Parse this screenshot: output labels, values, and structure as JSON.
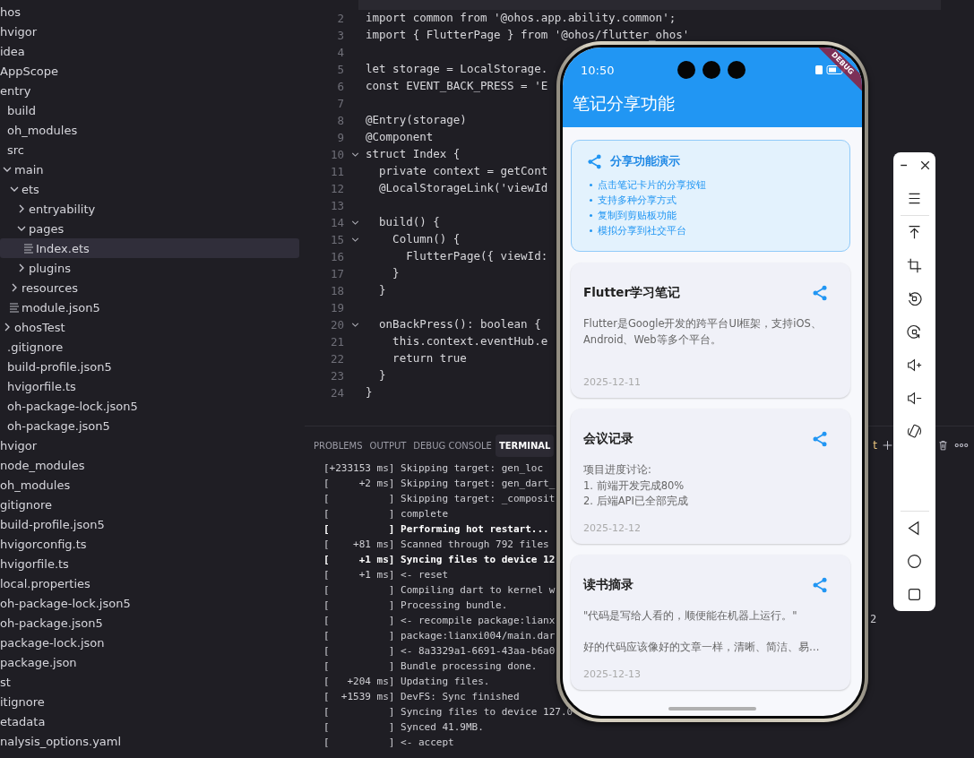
{
  "explorer": {
    "items": [
      {
        "name": "hos",
        "kind": "plain",
        "selected": false
      },
      {
        "name": "hvigor",
        "kind": "plain",
        "selected": false
      },
      {
        "name": "idea",
        "kind": "plain",
        "selected": false
      },
      {
        "name": "AppScope",
        "kind": "plain",
        "selected": false
      },
      {
        "name": "entry",
        "kind": "plain",
        "selected": false,
        "children": [
          {
            "name": "build",
            "kind": "plain",
            "selected": false
          },
          {
            "name": "oh_modules",
            "kind": "plain",
            "selected": false
          },
          {
            "name": "src",
            "kind": "plain",
            "selected": false,
            "children": [
              {
                "name": "main",
                "kind": "folder",
                "expanded": true,
                "selected": false,
                "children": [
                  {
                    "name": "ets",
                    "kind": "folder",
                    "expanded": true,
                    "selected": false,
                    "children": [
                      {
                        "name": "entryability",
                        "kind": "folder",
                        "expanded": false,
                        "selected": false
                      },
                      {
                        "name": "pages",
                        "kind": "folder",
                        "expanded": true,
                        "selected": false,
                        "children": [
                          {
                            "name": "Index.ets",
                            "kind": "file",
                            "selected": true
                          }
                        ]
                      },
                      {
                        "name": "plugins",
                        "kind": "folder",
                        "expanded": false,
                        "selected": false
                      }
                    ]
                  },
                  {
                    "name": "resources",
                    "kind": "folder",
                    "expanded": false,
                    "selected": false
                  },
                  {
                    "name": "module.json5",
                    "kind": "file",
                    "selected": false
                  }
                ]
              },
              {
                "name": "ohosTest",
                "kind": "folder",
                "expanded": false,
                "selected": false
              }
            ]
          },
          {
            "name": ".gitignore",
            "kind": "plain",
            "selected": false
          },
          {
            "name": "build-profile.json5",
            "kind": "plain",
            "selected": false
          },
          {
            "name": "hvigorfile.ts",
            "kind": "plain",
            "selected": false
          },
          {
            "name": "oh-package-lock.json5",
            "kind": "plain",
            "selected": false
          },
          {
            "name": "oh-package.json5",
            "kind": "plain",
            "selected": false
          }
        ]
      },
      {
        "name": "hvigor",
        "kind": "plain",
        "selected": false
      },
      {
        "name": "node_modules",
        "kind": "plain",
        "selected": false
      },
      {
        "name": "oh_modules",
        "kind": "plain",
        "selected": false
      },
      {
        "name": "gitignore",
        "kind": "plain",
        "selected": false
      },
      {
        "name": "build-profile.json5",
        "kind": "plain",
        "selected": false
      },
      {
        "name": "hvigorconfig.ts",
        "kind": "plain",
        "selected": false
      },
      {
        "name": "hvigorfile.ts",
        "kind": "plain",
        "selected": false
      },
      {
        "name": "local.properties",
        "kind": "plain",
        "selected": false
      },
      {
        "name": "oh-package-lock.json5",
        "kind": "plain",
        "selected": false
      },
      {
        "name": "oh-package.json5",
        "kind": "plain",
        "selected": false
      },
      {
        "name": "package-lock.json",
        "kind": "plain",
        "selected": false
      },
      {
        "name": "package.json",
        "kind": "plain",
        "selected": false
      },
      {
        "name": "st",
        "kind": "plain",
        "selected": false
      },
      {
        "name": "itignore",
        "kind": "plain",
        "selected": false
      },
      {
        "name": "etadata",
        "kind": "plain",
        "selected": false
      },
      {
        "name": "nalysis_options.yaml",
        "kind": "plain",
        "selected": false
      }
    ]
  },
  "editor": {
    "lines": [
      {
        "current": true,
        "foldable": false
      },
      {
        "number": "2",
        "text": "import common from '@ohos.app.ability.common';",
        "current": false,
        "foldable": false
      },
      {
        "number": "3",
        "text": "import { FlutterPage } from '@ohos/flutter_ohos'",
        "current": false,
        "foldable": false
      },
      {
        "number": "4",
        "current": false,
        "foldable": false
      },
      {
        "number": "5",
        "text": "let storage = LocalStorage.",
        "current": false,
        "foldable": false
      },
      {
        "number": "6",
        "text": "const EVENT_BACK_PRESS = 'E",
        "current": false,
        "foldable": false
      },
      {
        "number": "7",
        "current": false,
        "foldable": false
      },
      {
        "number": "8",
        "text": "@Entry(storage)",
        "current": false,
        "foldable": false
      },
      {
        "number": "9",
        "text": "@Component",
        "current": false,
        "foldable": false
      },
      {
        "number": "10",
        "text": "struct Index {",
        "current": false,
        "foldable": true
      },
      {
        "number": "11",
        "text": "  private context = getCont",
        "current": false,
        "foldable": false
      },
      {
        "number": "12",
        "text": "  @LocalStorageLink('viewId",
        "current": false,
        "foldable": false
      },
      {
        "number": "13",
        "current": false,
        "foldable": false
      },
      {
        "number": "14",
        "text": "  build() {",
        "current": false,
        "foldable": true
      },
      {
        "number": "15",
        "text": "    Column() {",
        "current": false,
        "foldable": true
      },
      {
        "number": "16",
        "text": "      FlutterPage({ viewId:",
        "current": false,
        "foldable": false
      },
      {
        "number": "17",
        "text": "    }",
        "current": false,
        "foldable": false
      },
      {
        "number": "18",
        "text": "  }",
        "current": false,
        "foldable": false
      },
      {
        "number": "19",
        "current": false,
        "foldable": false
      },
      {
        "number": "20",
        "text": "  onBackPress(): boolean {",
        "current": false,
        "foldable": true
      },
      {
        "number": "21",
        "text": "    this.context.eventHub.e",
        "current": false,
        "foldable": false
      },
      {
        "number": "22",
        "text": "    return true",
        "current": false,
        "foldable": false
      },
      {
        "number": "23",
        "text": "  }",
        "current": false,
        "foldable": false
      },
      {
        "number": "24",
        "text": "}",
        "current": false,
        "foldable": false
      }
    ]
  },
  "panel": {
    "tabs": [
      {
        "label": "PROBLEMS",
        "selected": false
      },
      {
        "label": "OUTPUT",
        "selected": false
      },
      {
        "label": "DEBUG CONSOLE",
        "selected": false
      },
      {
        "label": "TERMINAL",
        "selected": true
      }
    ],
    "tab_fragment": "t",
    "lines": [
      {
        "text": "[+233153 ms] Skipping target: gen_loc",
        "bold": false
      },
      {
        "text": "[     +2 ms] Skipping target: gen_dart_",
        "bold": false
      },
      {
        "text": "[          ] Skipping target: _composit",
        "bold": false
      },
      {
        "text": "[          ] complete",
        "bold": false
      },
      {
        "text": "[          ] Performing hot restart...",
        "bold": true
      },
      {
        "text": "[    +81 ms] Scanned through 792 files",
        "bold": false
      },
      {
        "text": "[     +1 ms] Syncing files to device 12",
        "bold": true
      },
      {
        "text": "[     +1 ms] <- reset",
        "bold": false
      },
      {
        "text": "[          ] Compiling dart to kernel w",
        "bold": false
      },
      {
        "text": "[          ] Processing bundle.",
        "bold": false
      },
      {
        "text": "[          ] <- recompile package:lianx",
        "bold": false
      },
      {
        "text": "[          ] package:lianxi004/main.dar",
        "bold": false
      },
      {
        "text": "[          ] <- 8a3329a1-6691-43aa-b6a0",
        "bold": false
      },
      {
        "text": "[          ] Bundle processing done.",
        "bold": false
      },
      {
        "text": "[   +204 ms] Updating files.",
        "bold": false
      },
      {
        "text": "[  +1539 ms] DevFS: Sync finished",
        "bold": false
      },
      {
        "text": "[          ] Syncing files to device 127.0",
        "bold": false
      },
      {
        "text": "[          ] Synced 41.9MB.",
        "bold": false
      },
      {
        "text": "[          ] <- accept",
        "bold": false
      }
    ],
    "line_fragment": "2"
  },
  "phone": {
    "time": "10:50",
    "banner": "DEBUG",
    "app_title": "笔记分享功能",
    "info_card": {
      "title": "分享功能演示",
      "bullets": [
        "点击笔记卡片的分享按钮",
        "支持多种分享方式",
        "复制到剪贴板功能",
        "模拟分享到社交平台"
      ]
    },
    "notes": [
      {
        "title": "Flutter学习笔记",
        "content": "Flutter是Google开发的跨平台UI框架，支持iOS、Android、Web等多个平台。",
        "date": "2025-12-11"
      },
      {
        "title": "会议记录",
        "content": "项目进度讨论:\n1. 前端开发完成80%\n2. 后端API已全部完成",
        "date": "2025-12-12"
      },
      {
        "title": "读书摘录",
        "content": "\"代码是写给人看的，顺便能在机器上运行。\"\n\n好的代码应该像好的文章一样，清晰、简洁、易…",
        "date": "2025-12-13"
      }
    ]
  }
}
